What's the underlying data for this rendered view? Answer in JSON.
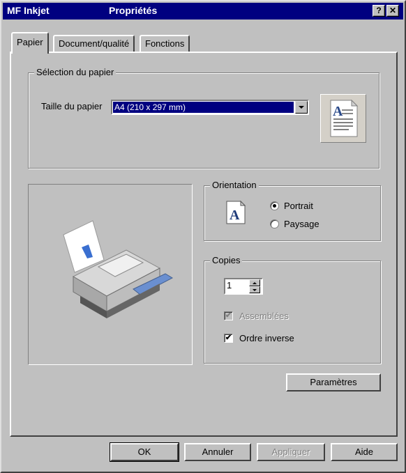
{
  "window": {
    "app_name": "MF Inkjet",
    "title": "Propriétés",
    "help_glyph": "?",
    "close_glyph": "✕"
  },
  "tabs": [
    {
      "label": "Papier",
      "active": true
    },
    {
      "label": "Document/qualité",
      "active": false
    },
    {
      "label": "Fonctions",
      "active": false
    }
  ],
  "paper_selection": {
    "group_label": "Sélection du papier",
    "size_label": "Taille du papier",
    "size_value": "A4 (210 x 297 mm)",
    "preview_icon": "document-icon"
  },
  "orientation": {
    "group_label": "Orientation",
    "icon_letter": "A",
    "options": [
      {
        "label": "Portrait",
        "checked": true
      },
      {
        "label": "Paysage",
        "checked": false
      }
    ]
  },
  "copies": {
    "group_label": "Copies",
    "count": "1",
    "collate_label": "Assemblées",
    "collate_checked": true,
    "collate_disabled": true,
    "reverse_label": "Ordre inverse",
    "reverse_checked": true,
    "check_glyph": "✔"
  },
  "printer_image": "printer-icon",
  "buttons": {
    "parameters": "Paramètres",
    "ok": "OK",
    "cancel": "Annuler",
    "apply": "Appliquer",
    "help": "Aide"
  }
}
